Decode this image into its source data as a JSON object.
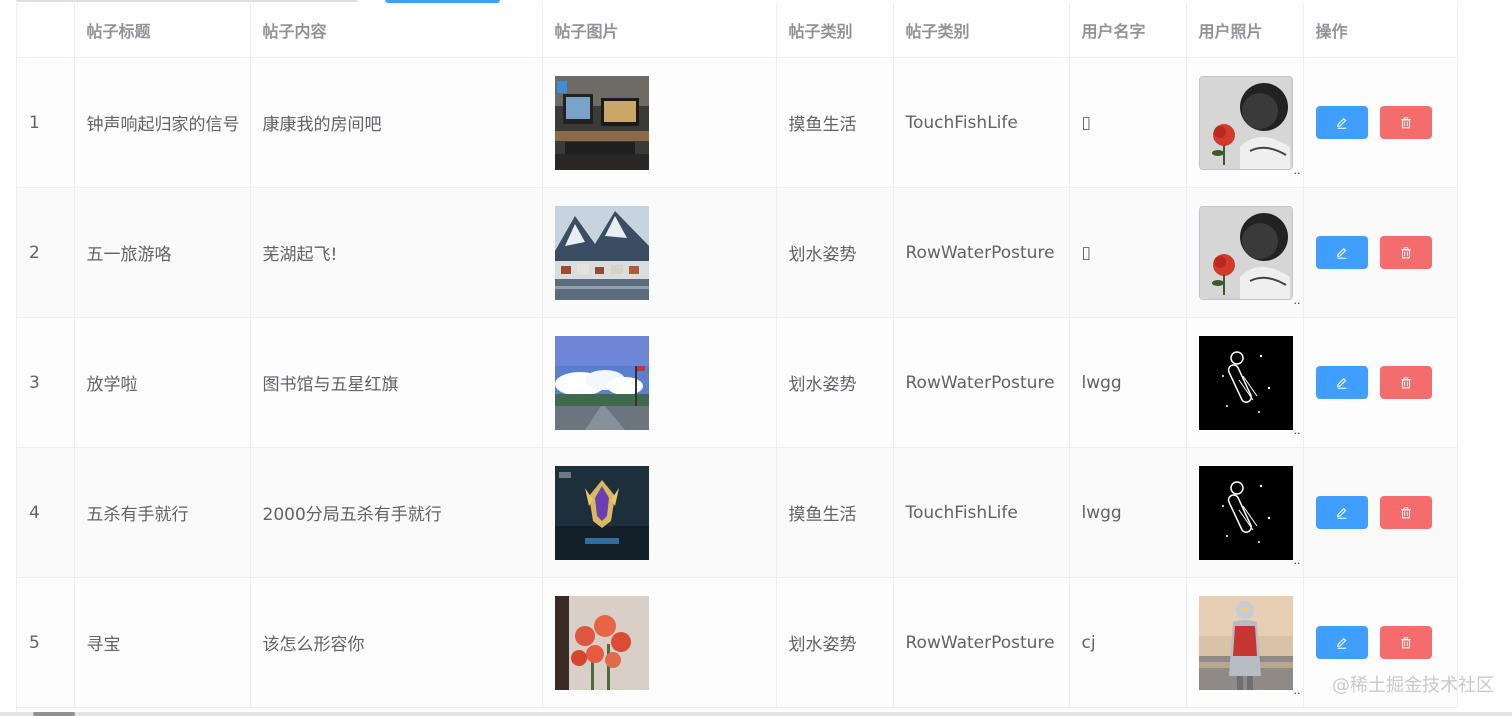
{
  "columns": [
    "",
    "帖子标题",
    "帖子内容",
    "帖子图片",
    "帖子类别",
    "帖子类别",
    "用户名字",
    "用户照片",
    "操作"
  ],
  "rows": [
    {
      "index": "1",
      "title": "钟声响起归家的信号",
      "content": "康康我的房间吧",
      "category_cn": "摸鱼生活",
      "category_en": "TouchFishLife",
      "username": "▯",
      "post_image": "desk-setup-photo",
      "avatar": "sketch-rose-avatar"
    },
    {
      "index": "2",
      "title": "五一旅游咯",
      "content": "芜湖起飞!",
      "category_cn": "划水姿势",
      "category_en": "RowWaterPosture",
      "username": "▯",
      "post_image": "snowy-village-photo",
      "avatar": "sketch-rose-avatar"
    },
    {
      "index": "3",
      "title": "放学啦",
      "content": "图书馆与五星红旗",
      "category_cn": "划水姿势",
      "category_en": "RowWaterPosture",
      "username": "lwgg",
      "post_image": "blue-sky-street-photo",
      "avatar": "astronaut-avatar"
    },
    {
      "index": "4",
      "title": "五杀有手就行",
      "content": "2000分局五杀有手就行",
      "category_cn": "摸鱼生活",
      "category_en": "TouchFishLife",
      "username": "lwgg",
      "post_image": "game-victory-screenshot",
      "avatar": "astronaut-avatar"
    },
    {
      "index": "5",
      "title": "寻宝",
      "content": "该怎么形容你",
      "category_cn": "划水姿势",
      "category_en": "RowWaterPosture",
      "username": "cj",
      "post_image": "red-roses-photo",
      "avatar": "hero-figure-avatar"
    }
  ],
  "avatar_more_glyph": "..",
  "actions": {
    "edit_icon": "edit-pencil-icon",
    "delete_icon": "trash-icon"
  },
  "watermark": "@稀土掘金技术社区",
  "colors": {
    "primary": "#409eff",
    "danger": "#f56c6c",
    "header_text": "#909399",
    "cell_text": "#606266",
    "border": "#ebeef5"
  }
}
